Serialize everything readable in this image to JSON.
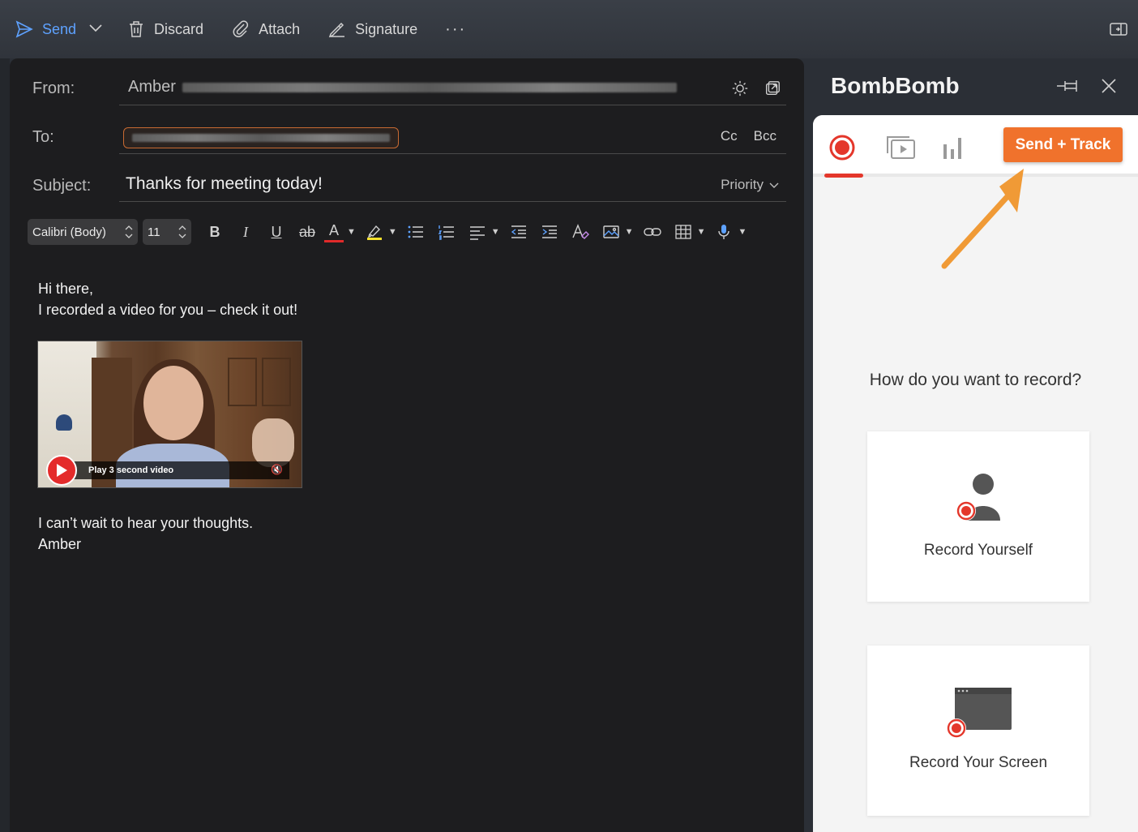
{
  "toolbar": {
    "send_label": "Send",
    "discard_label": "Discard",
    "attach_label": "Attach",
    "signature_label": "Signature",
    "more_label": "···"
  },
  "compose": {
    "from_label": "From:",
    "from_value": "Amber",
    "to_label": "To:",
    "cc_label": "Cc",
    "bcc_label": "Bcc",
    "subject_label": "Subject:",
    "subject_value": "Thanks for meeting today!",
    "priority_label": "Priority"
  },
  "format": {
    "font_name": "Calibri (Body)",
    "font_size": "11",
    "bold": "B",
    "italic": "I",
    "underline": "U",
    "strike": "ab",
    "font_color": "A"
  },
  "body": {
    "line1": "Hi there,",
    "line2": "I recorded a video for you – check it out!",
    "video_caption": "Play 3 second video",
    "line3": "I can’t wait to hear your thoughts.",
    "line4": "Amber"
  },
  "bombbomb": {
    "title": "BombBomb",
    "send_track_label": "Send + Track",
    "question": "How do you want to record?",
    "option_yourself": "Record Yourself",
    "option_screen": "Record Your Screen"
  },
  "colors": {
    "accent_blue": "#5ea2ff",
    "bombbomb_orange": "#f0722c",
    "record_red": "#e4372b"
  }
}
